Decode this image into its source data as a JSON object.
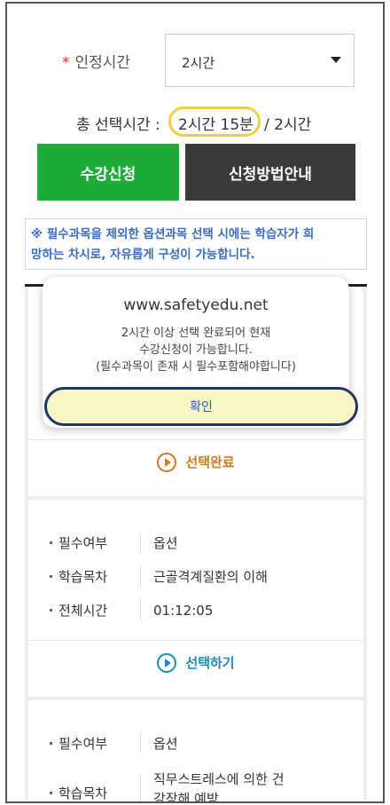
{
  "form": {
    "required_mark": "*",
    "time_label": "인정시간",
    "time_selected": "2시간",
    "total_label": "총 선택시간 :",
    "total_value": "2시간 15분",
    "total_sep": "/",
    "total_max": "2시간"
  },
  "buttons": {
    "apply": "수강신청",
    "guide": "신청방법안내"
  },
  "notice": {
    "line1": "※ 필수과목을 제외한 옵션과목 선택 시에는 학습자가 희",
    "line2": "망하는 차시로, 자유롭게 구성이 가능합니다."
  },
  "popup": {
    "site": "www.safetyedu.net",
    "line1": "2시간 이상 선택 완료되어 현재",
    "line2": "수강신청이 가능합니다.",
    "line3": "(필수과목이 존재 시 필수포함해야합니다)",
    "confirm": "확인"
  },
  "courses": [
    {
      "action": "선택완료",
      "action_icon": "play-circle-icon",
      "action_color": "#d07a20"
    },
    {
      "required_key": "필수여부",
      "required_val": "옵션",
      "subject_key": "학습목차",
      "subject_val": "근골격계질환의 이해",
      "time_key": "전체시간",
      "time_val": "01:12:05",
      "action": "선택하기",
      "action_icon": "play-circle-icon",
      "action_color": "#1e8ab8"
    },
    {
      "required_key": "필수여부",
      "required_val": "옵션",
      "subject_key": "학습목차",
      "subject_val_line1": "직무스트레스에 의한 건",
      "subject_val_line2": "강장해 예방"
    }
  ],
  "colors": {
    "apply_button": "#1faa3a",
    "guide_button": "#3a3a3a",
    "notice_text": "#3a6cc0",
    "highlight_ring": "#f0d040",
    "confirm_ring": "#1e3566"
  }
}
